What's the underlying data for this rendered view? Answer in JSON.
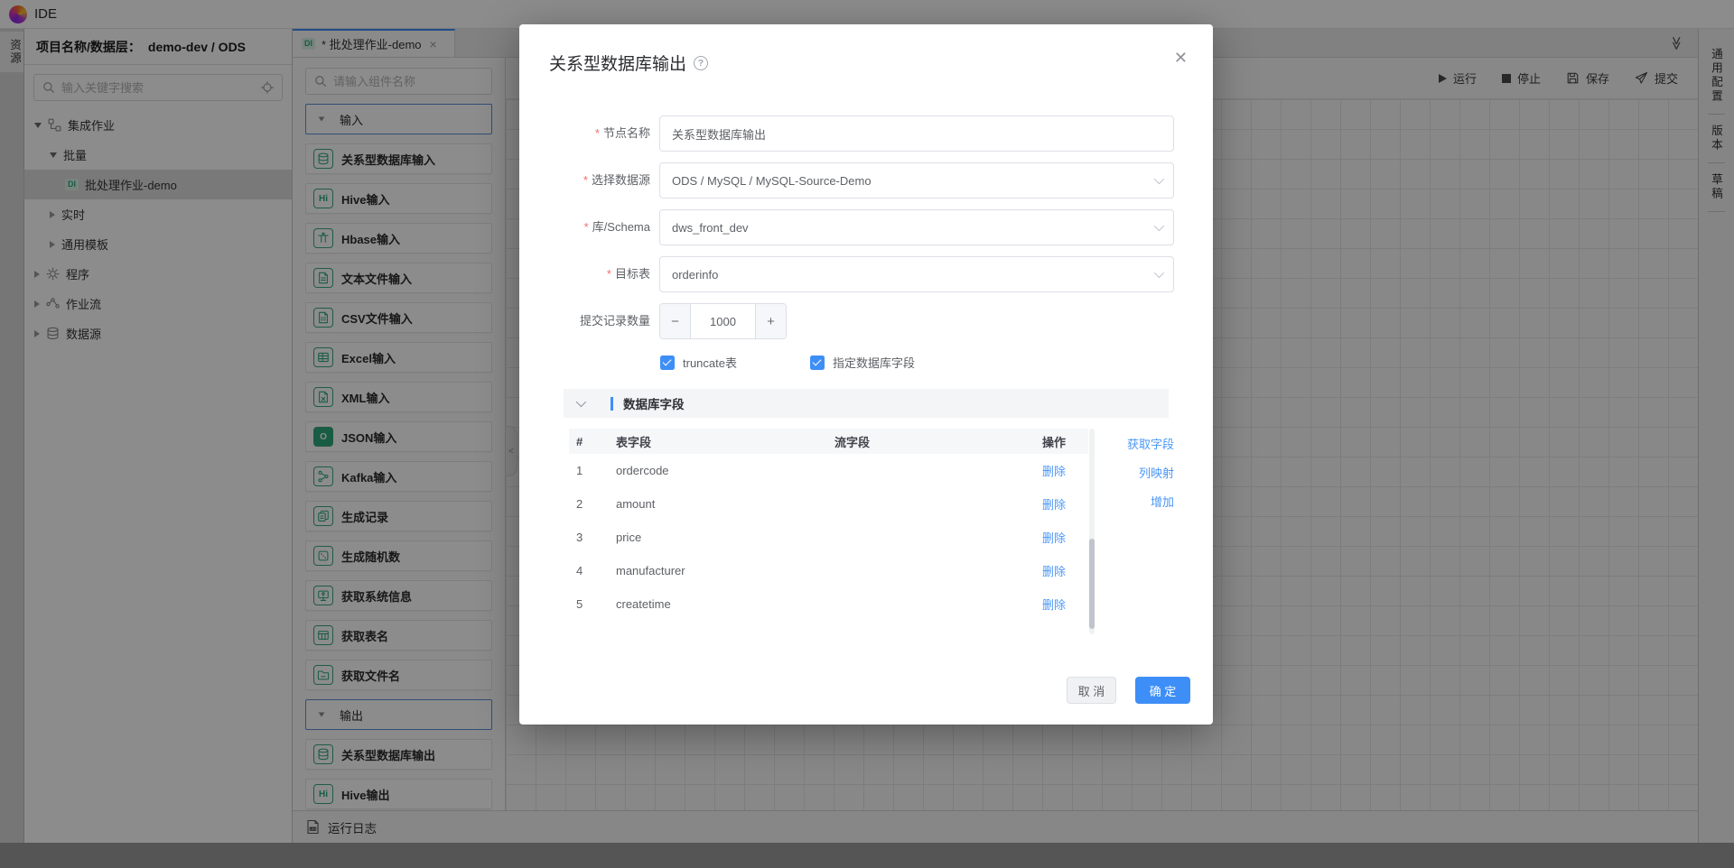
{
  "app": {
    "title": "IDE"
  },
  "colors": {
    "accent": "#3e8ef7",
    "green": "#2da87d"
  },
  "left_rail": {
    "active_tab": "资源"
  },
  "explorer": {
    "header_label": "项目名称/数据层：",
    "header_value": "demo-dev / ODS",
    "search_placeholder": "输入关键字搜索",
    "tree": [
      {
        "label": "集成作业",
        "indent": 0,
        "arrow": "down",
        "icon": "workflow"
      },
      {
        "label": "批量",
        "indent": 1,
        "arrow": "down"
      },
      {
        "label": "批处理作业-demo",
        "indent": 2,
        "badge": "DI",
        "selected": true
      },
      {
        "label": "实时",
        "indent": 1,
        "arrow": "right"
      },
      {
        "label": "通用模板",
        "indent": 1,
        "arrow": "right"
      },
      {
        "label": "程序",
        "indent": 0,
        "arrow": "right",
        "icon": "gear"
      },
      {
        "label": "作业流",
        "indent": 0,
        "arrow": "right",
        "icon": "flow"
      },
      {
        "label": "数据源",
        "indent": 0,
        "arrow": "right",
        "icon": "datasource"
      }
    ]
  },
  "editor": {
    "tab": {
      "badge": "DI",
      "title": "* 批处理作业-demo",
      "close": "×"
    },
    "palette_search_placeholder": "请输入组件名称",
    "sections": [
      {
        "title": "输入",
        "items": [
          {
            "label": "关系型数据库输入",
            "icon": "db"
          },
          {
            "label": "Hive输入",
            "icon": "hi"
          },
          {
            "label": "Hbase输入",
            "icon": "hbase"
          },
          {
            "label": "文本文件输入",
            "icon": "doc"
          },
          {
            "label": "CSV文件输入",
            "icon": "csv"
          },
          {
            "label": "Excel输入",
            "icon": "excel"
          },
          {
            "label": "XML输入",
            "icon": "xml"
          },
          {
            "label": "JSON输入",
            "icon": "json"
          },
          {
            "label": "Kafka输入",
            "icon": "kafka"
          },
          {
            "label": "生成记录",
            "icon": "records"
          },
          {
            "label": "生成随机数",
            "icon": "dice"
          },
          {
            "label": "获取系统信息",
            "icon": "monitor"
          },
          {
            "label": "获取表名",
            "icon": "tbl"
          },
          {
            "label": "获取文件名",
            "icon": "folder"
          }
        ]
      },
      {
        "title": "输出",
        "items": [
          {
            "label": "关系型数据库输出",
            "icon": "db"
          },
          {
            "label": "Hive输出",
            "icon": "hi"
          }
        ]
      }
    ],
    "toolbar": {
      "run": "运行",
      "stop": "停止",
      "save": "保存",
      "submit": "提交"
    },
    "log_bar": "运行日志"
  },
  "right_rail": {
    "tabs": [
      "通用配置",
      "版本",
      "草稿"
    ]
  },
  "modal": {
    "title": "关系型数据库输出",
    "fields": {
      "node_name": {
        "label": "节点名称",
        "required": true,
        "value": "关系型数据库输出"
      },
      "datasource": {
        "label": "选择数据源",
        "required": true,
        "value": "ODS / MySQL / MySQL-Source-Demo"
      },
      "schema": {
        "label": "库/Schema",
        "required": true,
        "value": "dws_front_dev"
      },
      "target_table": {
        "label": "目标表",
        "required": true,
        "value": "orderinfo"
      },
      "commit_count": {
        "label": "提交记录数量",
        "required": false,
        "value": "1000",
        "minus": "−",
        "plus": "+"
      }
    },
    "checkboxes": [
      {
        "label": "truncate表",
        "checked": true
      },
      {
        "label": "指定数据库字段",
        "checked": true
      }
    ],
    "fields_section_title": "数据库字段",
    "table": {
      "headers": [
        "#",
        "表字段",
        "流字段",
        "操作"
      ],
      "rows": [
        {
          "index": "1",
          "table_field": "ordercode",
          "stream_field": "",
          "action": "删除"
        },
        {
          "index": "2",
          "table_field": "amount",
          "stream_field": "",
          "action": "删除"
        },
        {
          "index": "3",
          "table_field": "price",
          "stream_field": "",
          "action": "删除"
        },
        {
          "index": "4",
          "table_field": "manufacturer",
          "stream_field": "",
          "action": "删除"
        },
        {
          "index": "5",
          "table_field": "createtime",
          "stream_field": "",
          "action": "删除"
        }
      ]
    },
    "side_actions": [
      "获取字段",
      "列映射",
      "增加"
    ],
    "footer": {
      "cancel": "取 消",
      "ok": "确 定"
    }
  }
}
